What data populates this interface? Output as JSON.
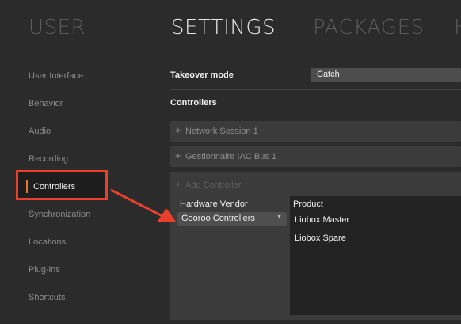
{
  "tabs": {
    "user": "USER",
    "settings": "SETTINGS",
    "packages": "PACKAGES",
    "partial": "H"
  },
  "sidebar": {
    "items": [
      {
        "label": "User Interface"
      },
      {
        "label": "Behavior"
      },
      {
        "label": "Audio"
      },
      {
        "label": "Recording"
      },
      {
        "label": "Controllers",
        "active": true
      },
      {
        "label": "Synchronization"
      },
      {
        "label": "Locations"
      },
      {
        "label": "Plug-ins"
      },
      {
        "label": "Shortcuts"
      }
    ]
  },
  "main": {
    "takeover_label": "Takeover mode",
    "takeover_value": "Catch",
    "controllers_label": "Controllers",
    "rows": [
      {
        "label": "Network Session 1"
      },
      {
        "label": "Gestionnaire IAC Bus 1"
      }
    ],
    "add_controller": "Add Controller",
    "plus_glyph": "+",
    "vendor_header": "Hardware Vendor",
    "vendor_value": "Gooroo Controllers",
    "product_header": "Product",
    "products": [
      "Liobox Master",
      "Liobox Spare"
    ]
  },
  "colors": {
    "annotation": "#e8402c",
    "active_indicator": "#e07a2a",
    "background": "#2b2b2b"
  }
}
